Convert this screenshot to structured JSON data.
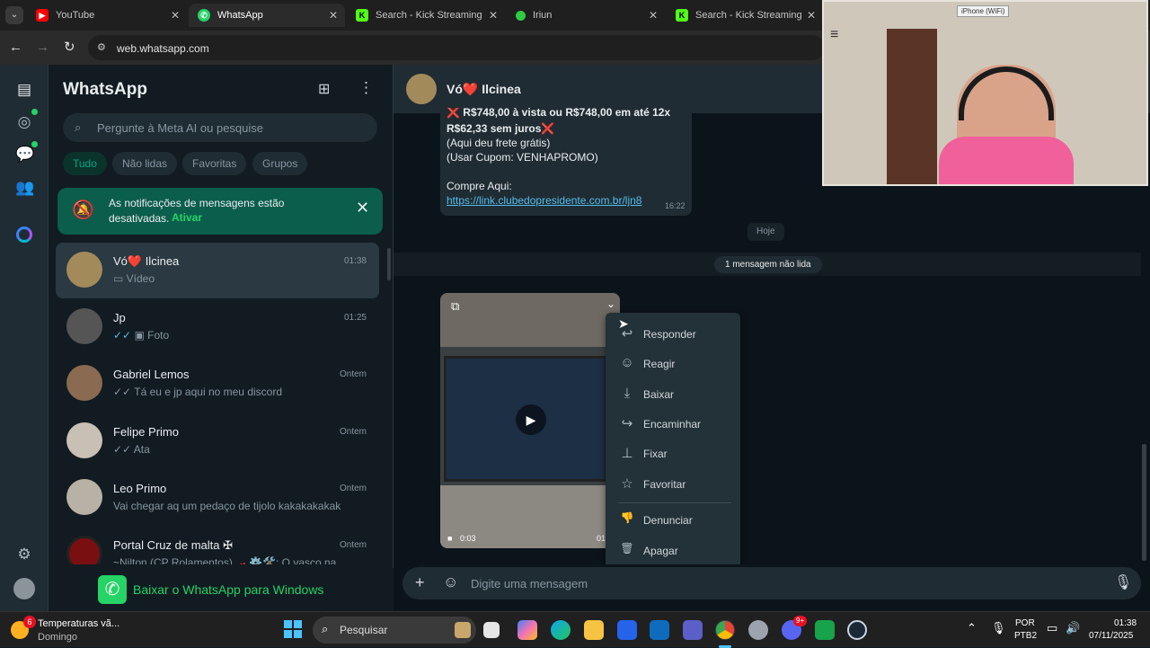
{
  "browser": {
    "tabs": [
      {
        "title": "YouTube",
        "favicon": "youtube-icon",
        "color": "#ff0000",
        "active": false
      },
      {
        "title": "WhatsApp",
        "favicon": "whatsapp-icon",
        "color": "#25d366",
        "active": true
      },
      {
        "title": "Search - Kick Streaming",
        "favicon": "kick-icon",
        "color": "#53fc18",
        "active": false
      },
      {
        "title": "Iriun",
        "favicon": "iriun-icon",
        "color": "#2ecc40",
        "active": false
      },
      {
        "title": "Search - Kick Streaming",
        "favicon": "kick-icon",
        "color": "#53fc18",
        "active": false
      }
    ],
    "url": "web.whatsapp.com"
  },
  "sidebar": {
    "title": "WhatsApp",
    "search_placeholder": "Pergunte à Meta AI ou pesquise",
    "filters": [
      "Tudo",
      "Não lidas",
      "Favoritas",
      "Grupos"
    ],
    "notice": {
      "text": "As notificações de mensagens estão desativadas.",
      "action": "Ativar"
    },
    "chats": [
      {
        "name": "Vó❤️ Ilcinea",
        "preview": "Vídeo",
        "time": "01:38",
        "icon": "video-icon"
      },
      {
        "name": "Jp",
        "preview": "Foto",
        "time": "01:25",
        "icon": "photo-icon",
        "ticks": "✓✓"
      },
      {
        "name": "Gabriel Lemos",
        "preview": "Tá eu e jp aqui no meu discord",
        "time": "Ontem",
        "ticks": "✓✓"
      },
      {
        "name": "Felipe Primo",
        "preview": "Ata",
        "time": "Ontem",
        "ticks": "✓✓"
      },
      {
        "name": "Leo Primo",
        "preview": "Vai chegar aq um pedaço de tijolo kakakakakak",
        "time": "Ontem"
      },
      {
        "name": "Portal Cruz de malta ✠",
        "preview": "~Nilton (CP Rolamentos)🏎️ ⚙️🛠️: O vasco na...",
        "time": "Ontem"
      }
    ],
    "download_banner": "Baixar o WhatsApp para Windows"
  },
  "chat": {
    "contact": "Vó❤️ Ilcinea",
    "message": {
      "line0": "❌ R$748,00 à vista ou R$748,00 em até 12x",
      "line1": "R$62,33 sem juros❌",
      "line2": "(Aqui deu frete grátis)",
      "line3": "(Usar Cupom: VENHAPROMO)",
      "line4": "Compre Aqui:",
      "link": "https://link.clubedopresidente.com.br/ljn8",
      "time": "16:22"
    },
    "date_divider": "Hoje",
    "unread_divider": "1 mensagem não lida",
    "video": {
      "duration": "0:03",
      "time": "01"
    },
    "context_menu": [
      {
        "label": "Responder",
        "icon": "reply-icon",
        "glyph": "↩"
      },
      {
        "label": "Reagir",
        "icon": "smile-icon",
        "glyph": "☺"
      },
      {
        "label": "Baixar",
        "icon": "download-icon",
        "glyph": "⤓"
      },
      {
        "label": "Encaminhar",
        "icon": "forward-icon",
        "glyph": "↪"
      },
      {
        "label": "Fixar",
        "icon": "pin-icon",
        "glyph": "⊥"
      },
      {
        "label": "Favoritar",
        "icon": "star-icon",
        "glyph": "☆"
      },
      {
        "label": "Denunciar",
        "icon": "thumbs-down-icon",
        "glyph": "👎"
      },
      {
        "label": "Apagar",
        "icon": "trash-icon",
        "glyph": "🗑"
      }
    ],
    "composer_placeholder": "Digite uma mensagem"
  },
  "webcam": {
    "label": "iPhone (WiFi)"
  },
  "taskbar": {
    "weather_title": "Temperaturas vã...",
    "weather_sub": "Domingo",
    "weather_badge": "6",
    "search_placeholder": "Pesquisar",
    "lang1": "POR",
    "lang2": "PTB2",
    "time": "01:38",
    "date": "07/11/2025",
    "discord_badge": "9+"
  }
}
